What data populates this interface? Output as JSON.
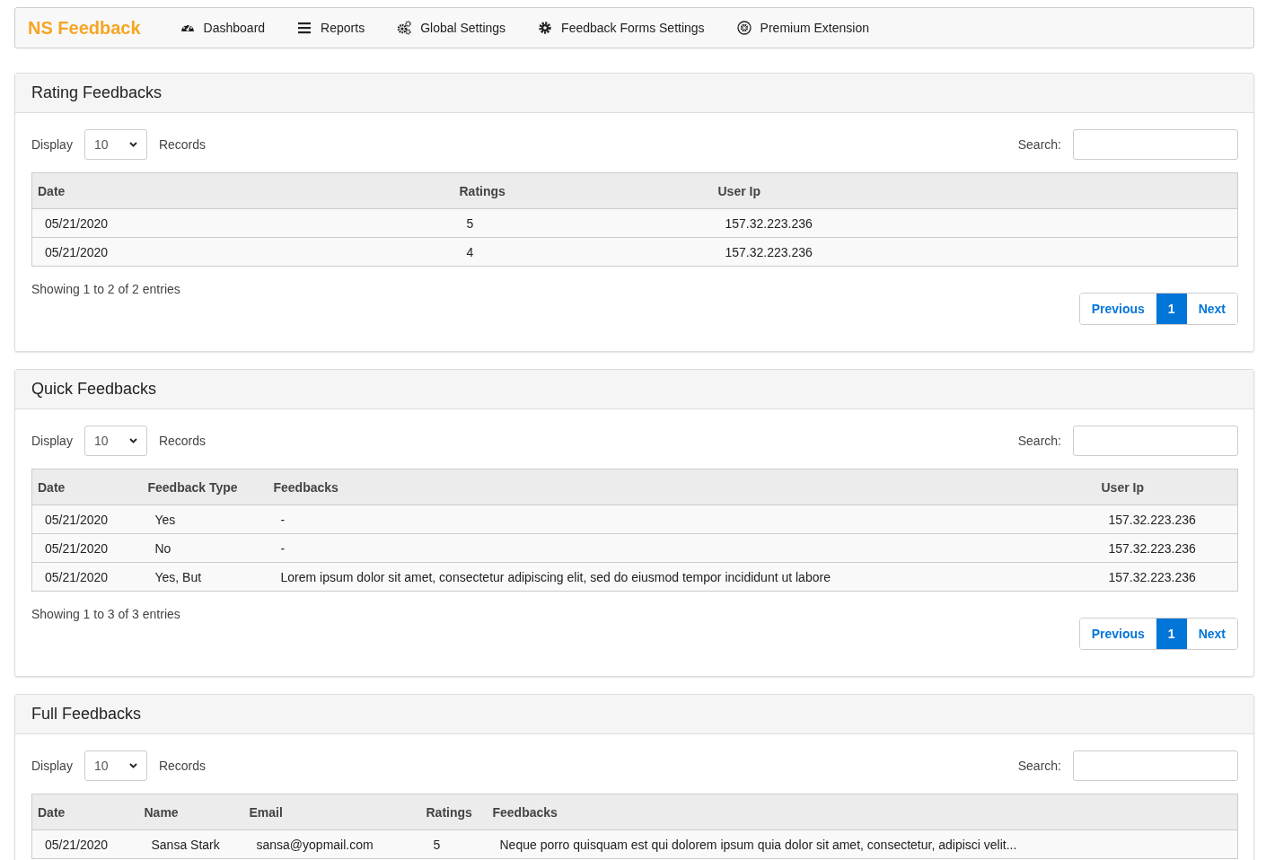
{
  "navbar": {
    "brand": "NS Feedback",
    "items": [
      {
        "label": "Dashboard",
        "kind": "gauge"
      },
      {
        "label": "Reports",
        "kind": "bars"
      },
      {
        "label": "Global Settings",
        "kind": "gears"
      },
      {
        "label": "Feedback Forms Settings",
        "kind": "gear"
      },
      {
        "label": "Premium Extension",
        "kind": "emblem"
      }
    ]
  },
  "panels": [
    {
      "title": "Rating Feedbacks",
      "display_label": "Display",
      "page_size": "10",
      "records_label": "Records",
      "search_label": "Search:",
      "table": {
        "columns": [
          "Date",
          "Ratings",
          "User Ip"
        ],
        "rows": [
          [
            "05/21/2020",
            "5",
            "157.32.223.236"
          ],
          [
            "05/21/2020",
            "4",
            "157.32.223.236"
          ]
        ]
      },
      "info": "Showing 1 to 2 of 2 entries",
      "pagination": {
        "previous": "Previous",
        "pages": [
          {
            "label": "1",
            "selected": true
          }
        ],
        "next": "Next"
      }
    },
    {
      "title": "Quick Feedbacks",
      "display_label": "Display",
      "page_size": "10",
      "records_label": "Records",
      "search_label": "Search:",
      "table": {
        "columns": [
          "Date",
          "Feedback Type",
          "Feedbacks",
          "User Ip"
        ],
        "rows": [
          [
            "05/21/2020",
            "Yes",
            "-",
            "157.32.223.236"
          ],
          [
            "05/21/2020",
            "No",
            "-",
            "157.32.223.236"
          ],
          [
            "05/21/2020",
            "Yes, But",
            "Lorem ipsum dolor sit amet, consectetur adipiscing elit, sed do eiusmod tempor incididunt ut labore",
            "157.32.223.236"
          ]
        ]
      },
      "info": "Showing 1 to 3 of 3 entries",
      "pagination": {
        "previous": "Previous",
        "pages": [
          {
            "label": "1",
            "selected": true
          }
        ],
        "next": "Next"
      }
    },
    {
      "title": "Full Feedbacks",
      "display_label": "Display",
      "page_size": "10",
      "records_label": "Records",
      "search_label": "Search:",
      "table": {
        "columns": [
          "Date",
          "Name",
          "Email",
          "Ratings",
          "Feedbacks"
        ],
        "rows": [
          [
            "05/21/2020",
            "Sansa Stark",
            "sansa@yopmail.com",
            "5",
            "Neque porro quisquam est qui dolorem ipsum quia dolor sit amet, consectetur, adipisci velit..."
          ]
        ]
      }
    }
  ]
}
